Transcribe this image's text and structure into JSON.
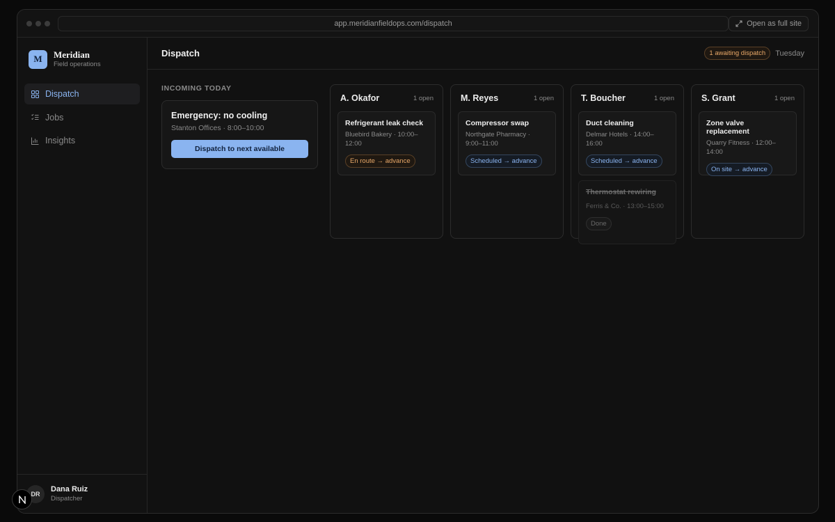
{
  "browser": {
    "url": "app.meridianfieldops.com/dispatch",
    "open_full_label": "Open as full site"
  },
  "brand": {
    "logo_letter": "M",
    "name": "Meridian",
    "subtitle": "Field operations"
  },
  "nav": [
    {
      "label": "Dispatch",
      "icon": "grid-icon",
      "active": true
    },
    {
      "label": "Jobs",
      "icon": "checklist-icon",
      "active": false
    },
    {
      "label": "Insights",
      "icon": "bar-chart-icon",
      "active": false
    }
  ],
  "user": {
    "initials": "DR",
    "name": "Dana Ruiz",
    "role": "Dispatcher"
  },
  "header": {
    "title": "Dispatch",
    "awaiting_badge": "1 awaiting dispatch",
    "day": "Tuesday"
  },
  "incoming": {
    "label": "INCOMING TODAY",
    "card": {
      "title": "Emergency: no cooling",
      "subtitle": "Stanton Offices · 8:00–10:00",
      "button": "Dispatch to next available"
    }
  },
  "columns": [
    {
      "name": "A. Okafor",
      "open": "1 open",
      "jobs": [
        {
          "title": "Refrigerant leak check",
          "meta": "Bluebird Bakery · 10:00–12:00",
          "status": "En route → advance"
        }
      ]
    },
    {
      "name": "M. Reyes",
      "open": "1 open",
      "jobs": [
        {
          "title": "Compressor swap",
          "meta": "Northgate Pharmacy · 9:00–11:00",
          "status": "Scheduled → advance"
        }
      ]
    },
    {
      "name": "T. Boucher",
      "open": "1 open",
      "jobs": [
        {
          "title": "Duct cleaning",
          "meta": "Delmar Hotels · 14:00–16:00",
          "status": "Scheduled → advance"
        },
        {
          "title": "Thermostat rewiring",
          "meta": "Ferris & Co. · 13:00–15:00",
          "status": "Done"
        }
      ]
    },
    {
      "name": "S. Grant",
      "open": "1 open",
      "jobs": [
        {
          "title": "Zone valve replacement",
          "meta": "Quarry Fitness · 12:00–14:00",
          "status": "On site → advance"
        }
      ]
    }
  ],
  "colors": {
    "accent": "#8ab4f0",
    "warning": "#e8a868",
    "background": "#0a0a0a"
  }
}
